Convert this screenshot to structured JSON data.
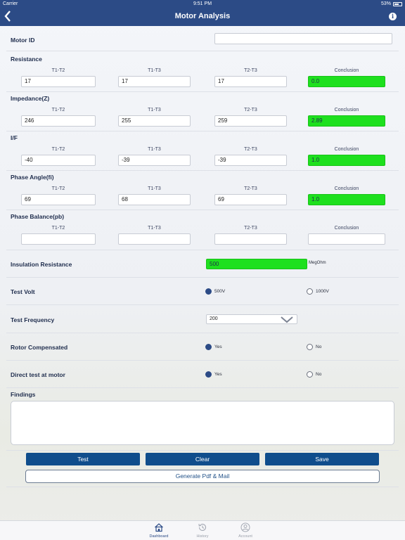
{
  "status_bar": {
    "carrier": "Carrier",
    "time": "9:51 PM",
    "battery": "53%"
  },
  "nav": {
    "title": "Motor Analysis",
    "back_icon": "chevron-left-icon",
    "info_icon": "info-icon"
  },
  "motor_id": {
    "label": "Motor ID",
    "value": ""
  },
  "columns": {
    "t1t2": "T1-T2",
    "t1t3": "T1-T3",
    "t2t3": "T2-T3",
    "conclusion": "Conclusion"
  },
  "sections": [
    {
      "label": "Resistance",
      "t1t2": "17",
      "t1t3": "17",
      "t2t3": "17",
      "conclusion": "0.0",
      "conclusion_color": "#1ee01e"
    },
    {
      "label": "Impedance(Z)",
      "t1t2": "246",
      "t1t3": "255",
      "t2t3": "259",
      "conclusion": "2.89",
      "conclusion_color": "#1ee01e"
    },
    {
      "label": "I/F",
      "t1t2": "-40",
      "t1t3": "-39",
      "t2t3": "-39",
      "conclusion": "1.0",
      "conclusion_color": "#1ee01e"
    },
    {
      "label": "Phase Angle(fi)",
      "t1t2": "69",
      "t1t3": "68",
      "t2t3": "69",
      "conclusion": "1.0",
      "conclusion_color": "#1ee01e"
    },
    {
      "label": "Phase Balance(pb)",
      "t1t2": "",
      "t1t3": "",
      "t2t3": "",
      "conclusion": "",
      "conclusion_color": "#ffffff"
    }
  ],
  "insulation": {
    "label": "Insulation Resistance",
    "value": "500",
    "unit": "MegOhm"
  },
  "test_volt": {
    "label": "Test Volt",
    "option_a": "500V",
    "option_b": "1000V",
    "selected": "500V"
  },
  "test_frequency": {
    "label": "Test Frequency",
    "value": "200"
  },
  "rotor_compensated": {
    "label": "Rotor Compensated",
    "option_a": "Yes",
    "option_b": "No",
    "selected": "Yes"
  },
  "direct_test": {
    "label": "Direct test at motor",
    "option_a": "Yes",
    "option_b": "No",
    "selected": "Yes"
  },
  "findings": {
    "label": "Findings",
    "value": ""
  },
  "buttons": {
    "test": "Test",
    "clear": "Clear",
    "save": "Save",
    "generate": "Generate Pdf & Mail"
  },
  "tabs": [
    {
      "label": "Dashboard",
      "icon": "home-icon",
      "active": true
    },
    {
      "label": "History",
      "icon": "history-icon",
      "active": false
    },
    {
      "label": "Account",
      "icon": "account-icon",
      "active": false
    }
  ],
  "colors": {
    "primary": "#2c4b86",
    "button": "#0f4d8c",
    "ok": "#1ee01e"
  }
}
